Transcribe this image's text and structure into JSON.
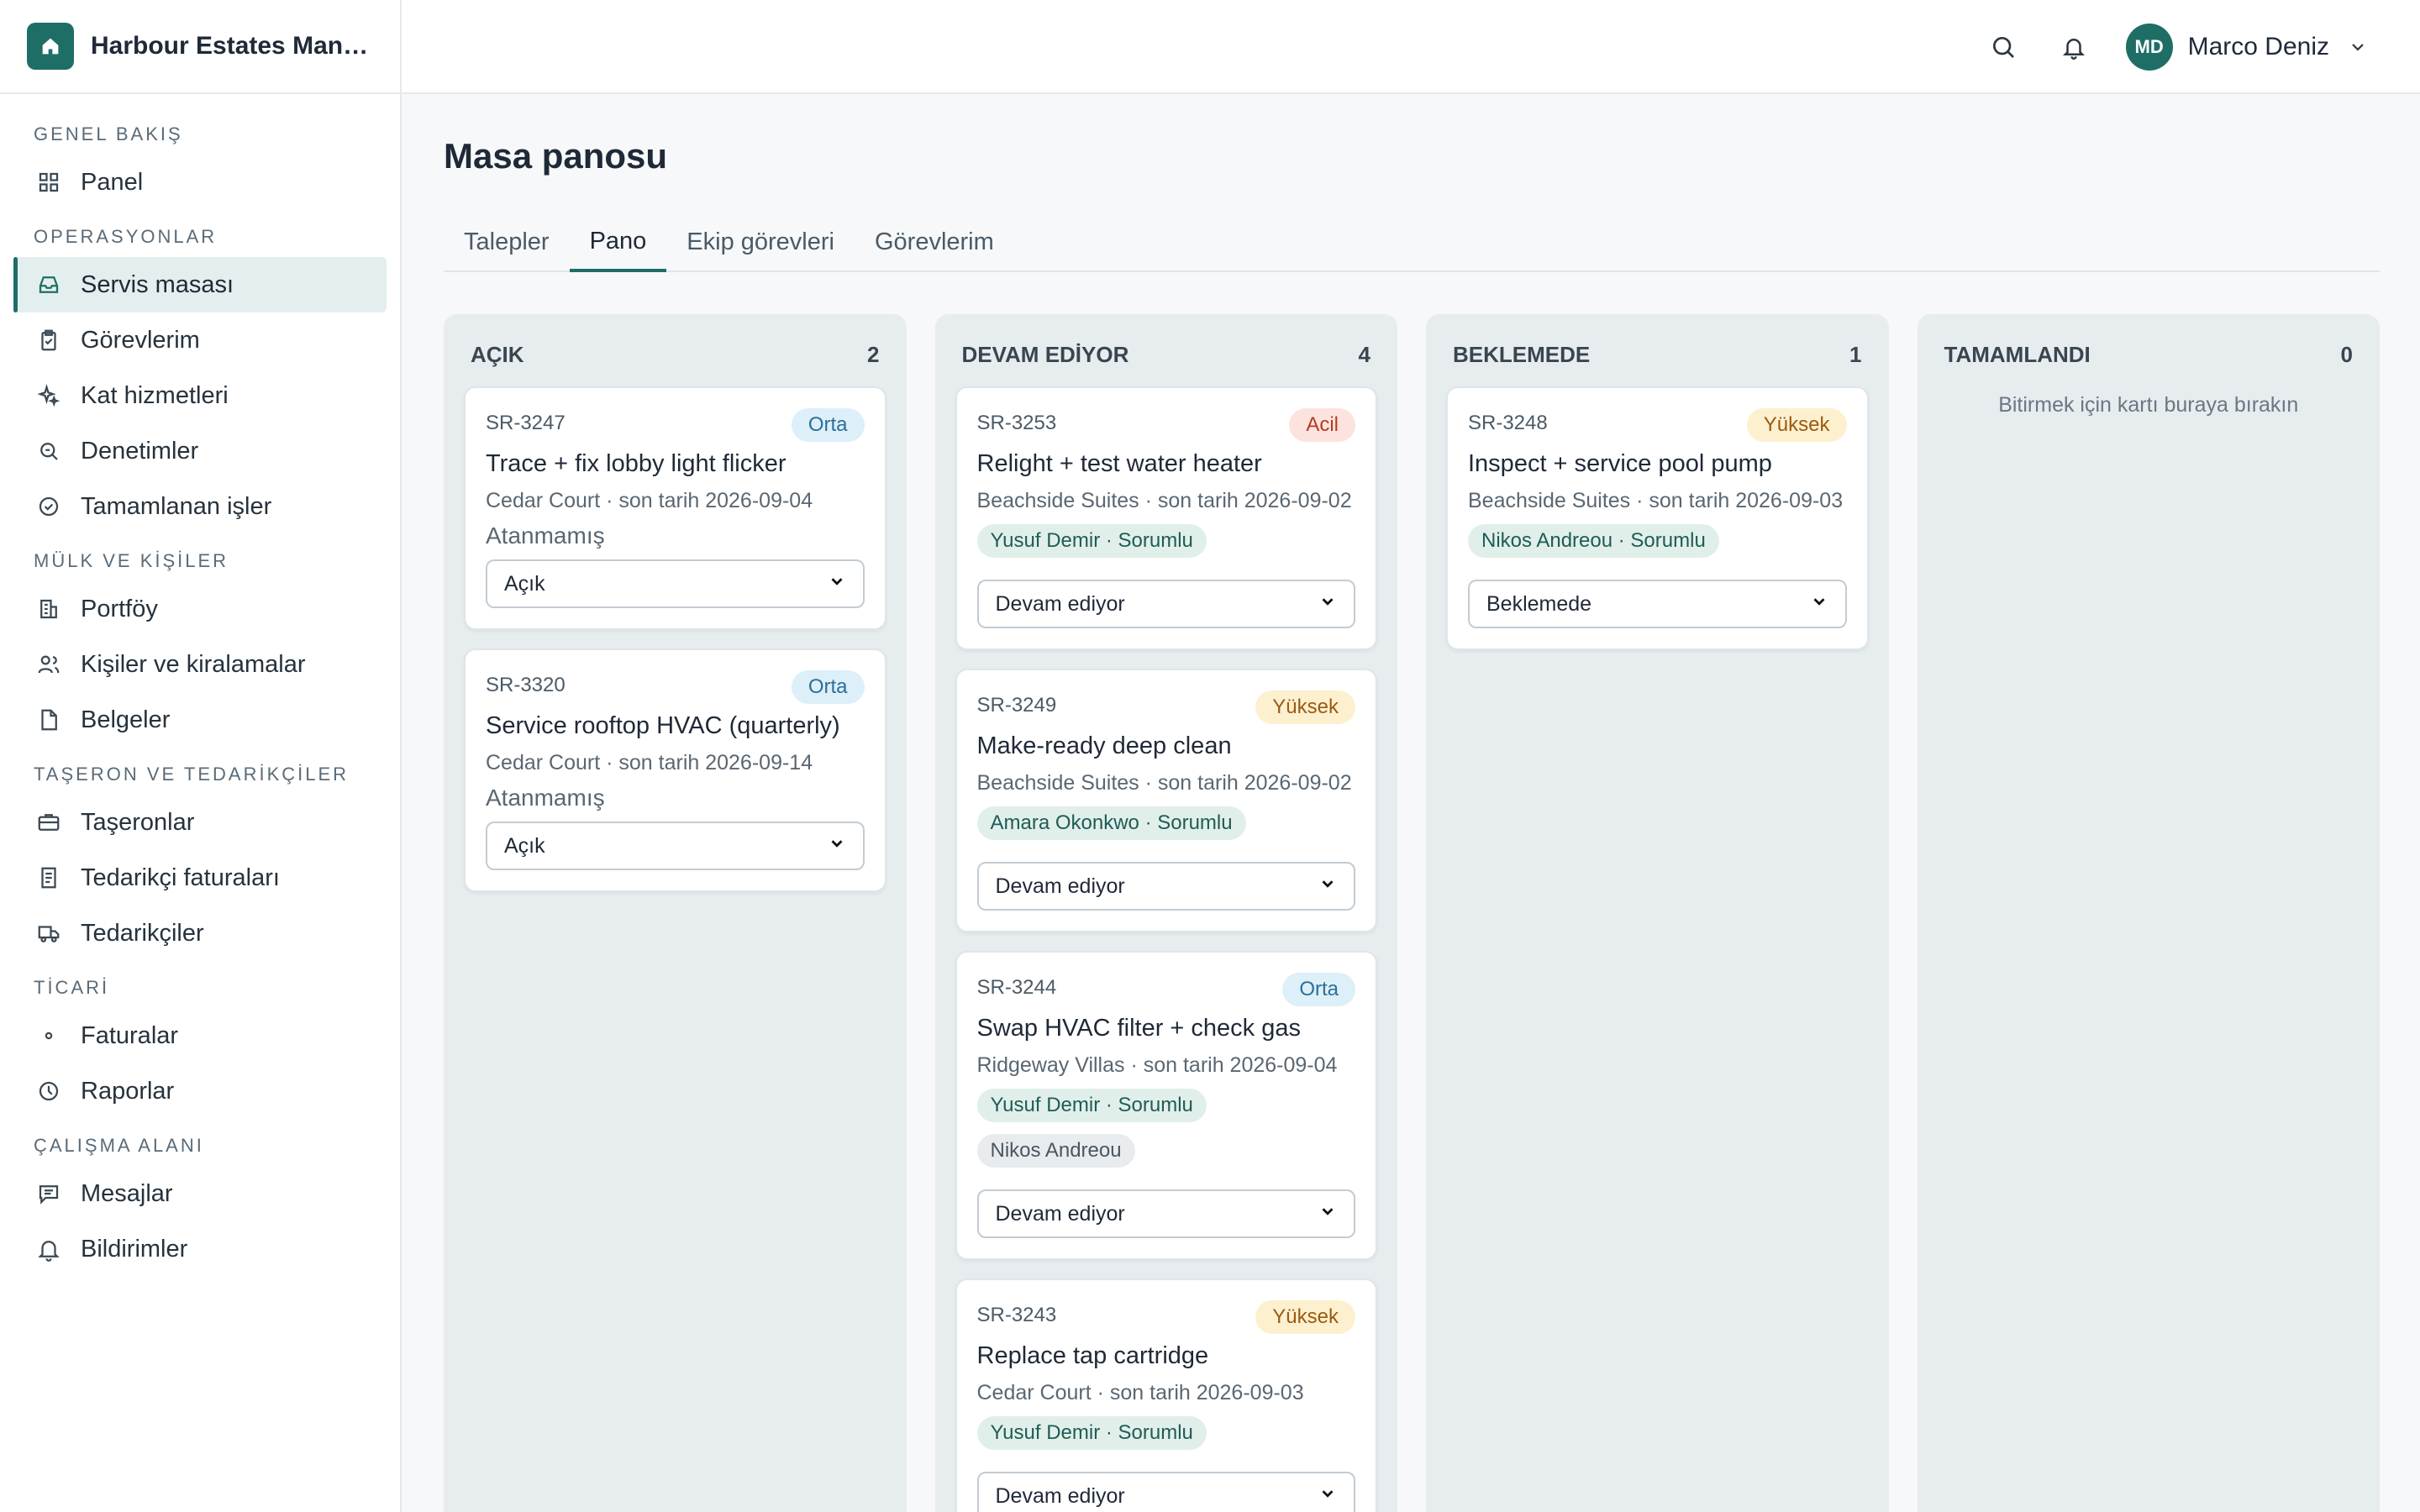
{
  "brand": {
    "name": "Harbour Estates Manag..."
  },
  "user": {
    "initials": "MD",
    "name": "Marco Deniz"
  },
  "nav": {
    "sections": [
      {
        "title": "GENEL BAKIŞ",
        "items": [
          {
            "label": "Panel",
            "icon": "grid-icon"
          }
        ]
      },
      {
        "title": "OPERASYONLAR",
        "items": [
          {
            "label": "Servis masası",
            "icon": "inbox-icon",
            "active": true
          },
          {
            "label": "Görevlerim",
            "icon": "clipboard-check-icon"
          },
          {
            "label": "Kat hizmetleri",
            "icon": "sparkles-icon"
          },
          {
            "label": "Denetimler",
            "icon": "search-doc-icon"
          },
          {
            "label": "Tamamlanan işler",
            "icon": "check-circle-icon"
          }
        ]
      },
      {
        "title": "MÜLK VE KİŞİLER",
        "items": [
          {
            "label": "Portföy",
            "icon": "building-icon"
          },
          {
            "label": "Kişiler ve kiralamalar",
            "icon": "users-icon"
          },
          {
            "label": "Belgeler",
            "icon": "document-icon"
          }
        ]
      },
      {
        "title": "TAŞERON VE TEDARİKÇİLER",
        "items": [
          {
            "label": "Taşeronlar",
            "icon": "briefcase-icon"
          },
          {
            "label": "Tedarikçi faturaları",
            "icon": "receipt-icon"
          },
          {
            "label": "Tedarikçiler",
            "icon": "truck-icon"
          }
        ]
      },
      {
        "title": "TİCARİ",
        "items": [
          {
            "label": "Faturalar",
            "icon": "dot-icon"
          },
          {
            "label": "Raporlar",
            "icon": "clock-icon"
          }
        ]
      },
      {
        "title": "ÇALIŞMA ALANI",
        "items": [
          {
            "label": "Mesajlar",
            "icon": "message-icon"
          },
          {
            "label": "Bildirimler",
            "icon": "bell-icon"
          }
        ]
      }
    ]
  },
  "page": {
    "title": "Masa panosu",
    "tabs": [
      "Talepler",
      "Pano",
      "Ekip görevleri",
      "Görevlerim"
    ],
    "active_tab": 1
  },
  "board": {
    "columns": [
      {
        "title": "AÇIK",
        "count": "2",
        "cards": [
          {
            "id": "SR-3247",
            "priority": "Orta",
            "priority_class": "orta",
            "title": "Trace + fix lobby light flicker",
            "meta": "Cedar Court · son tarih 2026-09-04",
            "unassigned": "Atanmamış",
            "owners": [],
            "members": [],
            "status": "Açık"
          },
          {
            "id": "SR-3320",
            "priority": "Orta",
            "priority_class": "orta",
            "title": "Service rooftop HVAC (quarterly)",
            "meta": "Cedar Court · son tarih 2026-09-14",
            "unassigned": "Atanmamış",
            "owners": [],
            "members": [],
            "status": "Açık"
          }
        ]
      },
      {
        "title": "DEVAM EDİYOR",
        "count": "4",
        "cards": [
          {
            "id": "SR-3253",
            "priority": "Acil",
            "priority_class": "acil",
            "title": "Relight + test water heater",
            "meta": "Beachside Suites · son tarih 2026-09-02",
            "owners": [
              "Yusuf Demir · Sorumlu"
            ],
            "members": [],
            "status": "Devam ediyor"
          },
          {
            "id": "SR-3249",
            "priority": "Yüksek",
            "priority_class": "yuksek",
            "title": "Make-ready deep clean",
            "meta": "Beachside Suites · son tarih 2026-09-02",
            "owners": [
              "Amara Okonkwo · Sorumlu"
            ],
            "members": [],
            "status": "Devam ediyor"
          },
          {
            "id": "SR-3244",
            "priority": "Orta",
            "priority_class": "orta",
            "title": "Swap HVAC filter + check gas",
            "meta": "Ridgeway Villas · son tarih 2026-09-04",
            "owners": [
              "Yusuf Demir · Sorumlu"
            ],
            "members": [
              "Nikos Andreou"
            ],
            "status": "Devam ediyor"
          },
          {
            "id": "SR-3243",
            "priority": "Yüksek",
            "priority_class": "yuksek",
            "title": "Replace tap cartridge",
            "meta": "Cedar Court · son tarih 2026-09-03",
            "owners": [
              "Yusuf Demir · Sorumlu"
            ],
            "members": [],
            "status": "Devam ediyor"
          }
        ]
      },
      {
        "title": "BEKLEMEDE",
        "count": "1",
        "cards": [
          {
            "id": "SR-3248",
            "priority": "Yüksek",
            "priority_class": "yuksek",
            "title": "Inspect + service pool pump",
            "meta": "Beachside Suites · son tarih 2026-09-03",
            "owners": [
              "Nikos Andreou · Sorumlu"
            ],
            "members": [],
            "status": "Beklemede"
          }
        ]
      },
      {
        "title": "TAMAMLANDI",
        "count": "0",
        "cards": [],
        "empty_hint": "Bitirmek için kartı buraya bırakın"
      }
    ]
  },
  "colors": {
    "accent": "#1e6e66",
    "background": "#f6f8f9",
    "column": "#e7ecef"
  }
}
